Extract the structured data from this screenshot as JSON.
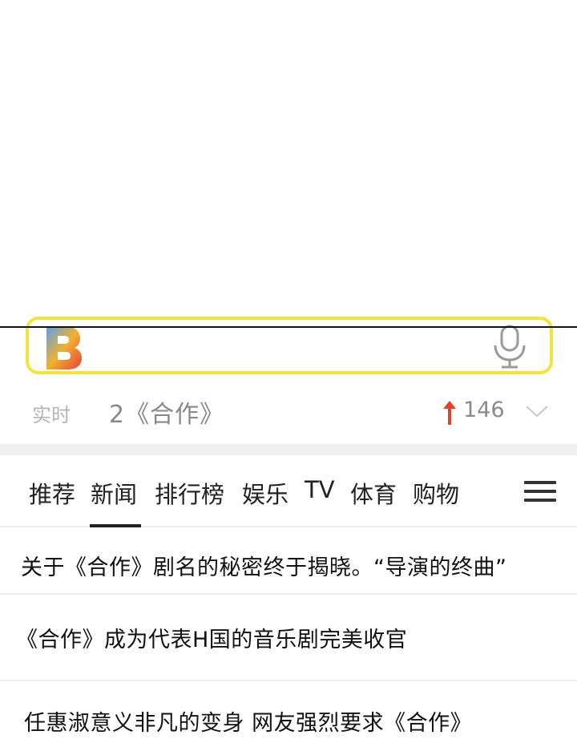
{
  "search": {
    "logo_letter": "B"
  },
  "trending": {
    "label": "实时",
    "text": "2《合作》",
    "count": "146"
  },
  "tabs": [
    {
      "label": "推荐"
    },
    {
      "label": "新闻"
    },
    {
      "label": "排行榜"
    },
    {
      "label": "娱乐"
    },
    {
      "label": "TV"
    },
    {
      "label": "体育"
    },
    {
      "label": "购物"
    }
  ],
  "active_tab": "新闻",
  "news": [
    {
      "title": "关于《合作》剧名的秘密终于揭晓。“导演的终曲”"
    },
    {
      "title": "《合作》成为代表H国的音乐剧完美收官"
    },
    {
      "title": "任惠淑意义非凡的变身 网友强烈要求《合作》"
    }
  ],
  "colors": {
    "accent_yellow": "#f2e43a",
    "trend_up_red": "#e0452b"
  },
  "icons": [
    "logo-icon",
    "microphone-icon",
    "arrow-up-icon",
    "chevron-down-icon",
    "hamburger-menu-icon"
  ]
}
